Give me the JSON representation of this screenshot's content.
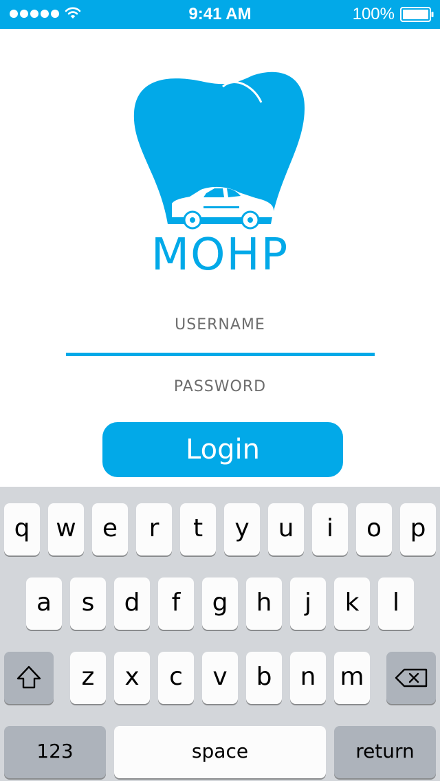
{
  "status_bar": {
    "time": "9:41 AM",
    "battery_percent": "100%",
    "icons": [
      "signal-dots-icon",
      "wifi-icon",
      "battery-icon"
    ]
  },
  "logo": {
    "text": "MOHP",
    "icons": [
      "tooth-icon",
      "car-icon"
    ]
  },
  "form": {
    "username_label": "USERNAME",
    "password_label": "PASSWORD",
    "login_label": "Login"
  },
  "keyboard": {
    "row1": [
      "q",
      "w",
      "e",
      "r",
      "t",
      "y",
      "u",
      "i",
      "o",
      "p"
    ],
    "row2": [
      "a",
      "s",
      "d",
      "f",
      "g",
      "h",
      "j",
      "k",
      "l"
    ],
    "row3": [
      "z",
      "x",
      "c",
      "v",
      "b",
      "n",
      "m"
    ],
    "numbers_label": "123",
    "space_label": "space",
    "return_label": "return",
    "shift_icon": "shift-icon",
    "backspace_icon": "backspace-icon"
  },
  "colors": {
    "accent": "#02a9e8",
    "label_gray": "#6d6d6d",
    "keyboard_bg": "#d3d6da",
    "key_bg": "#fcfcfc",
    "key_dark_bg": "#adb3bb"
  }
}
